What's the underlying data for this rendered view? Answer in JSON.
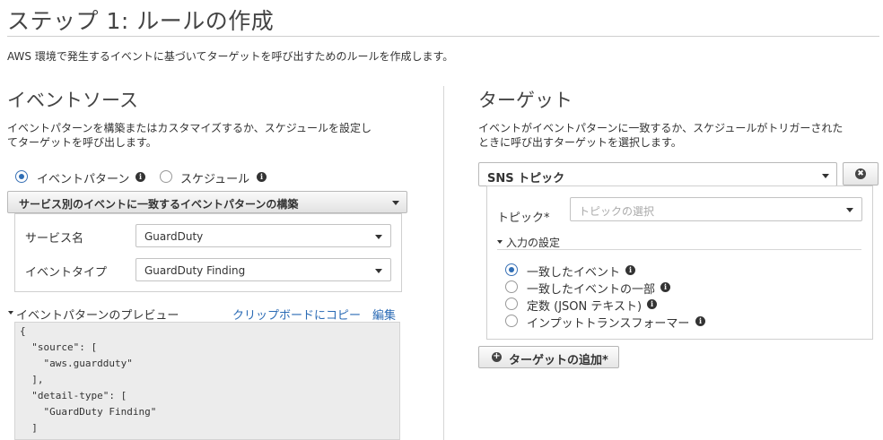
{
  "page": {
    "title": "ステップ 1: ルールの作成",
    "description": "AWS 環境で発生するイベントに基づいてターゲットを呼び出すためのルールを作成します。"
  },
  "event_source": {
    "heading": "イベントソース",
    "desc_line1": "イベントパターンを構築またはカスタマイズするか、スケジュールを設定し",
    "desc_line2": "てターゲットを呼び出します。",
    "radio_pattern_label": "イベントパターン",
    "radio_schedule_label": "スケジュール",
    "selected_radio": "イベントパターン",
    "builder_label": "サービス別のイベントに一致するイベントパターンの構築",
    "service_name_label": "サービス名",
    "service_name_value": "GuardDuty",
    "event_type_label": "イベントタイプ",
    "event_type_value": "GuardDuty Finding",
    "preview_label": "イベントパターンのプレビュー",
    "copy_link": "クリップボードにコピー",
    "edit_link": "編集",
    "code_lines": [
      "{",
      "  \"source\": [",
      "    \"aws.guardduty\"",
      "  ],",
      "  \"detail-type\": [",
      "    \"GuardDuty Finding\"",
      "  ]"
    ]
  },
  "target": {
    "heading": "ターゲット",
    "desc_line1": "イベントがイベントパターンに一致するか、スケジュールがトリガーされた",
    "desc_line2": "ときに呼び出すターゲットを選択します。",
    "type_value": "SNS トピック",
    "topic_label": "トピック*",
    "topic_placeholder": "トピックの選択",
    "input_settings_label": "入力の設定",
    "input_options": [
      "一致したイベント",
      "一致したイベントの一部",
      "定数 (JSON テキスト)",
      "インプットトランスフォーマー"
    ],
    "selected_input": "一致したイベント",
    "add_target_label": "ターゲットの追加*"
  },
  "icons": {
    "info": "i",
    "remove": "✖",
    "add": "+"
  },
  "colors": {
    "accent": "#2f6eb5",
    "link": "#2b6bb5"
  }
}
